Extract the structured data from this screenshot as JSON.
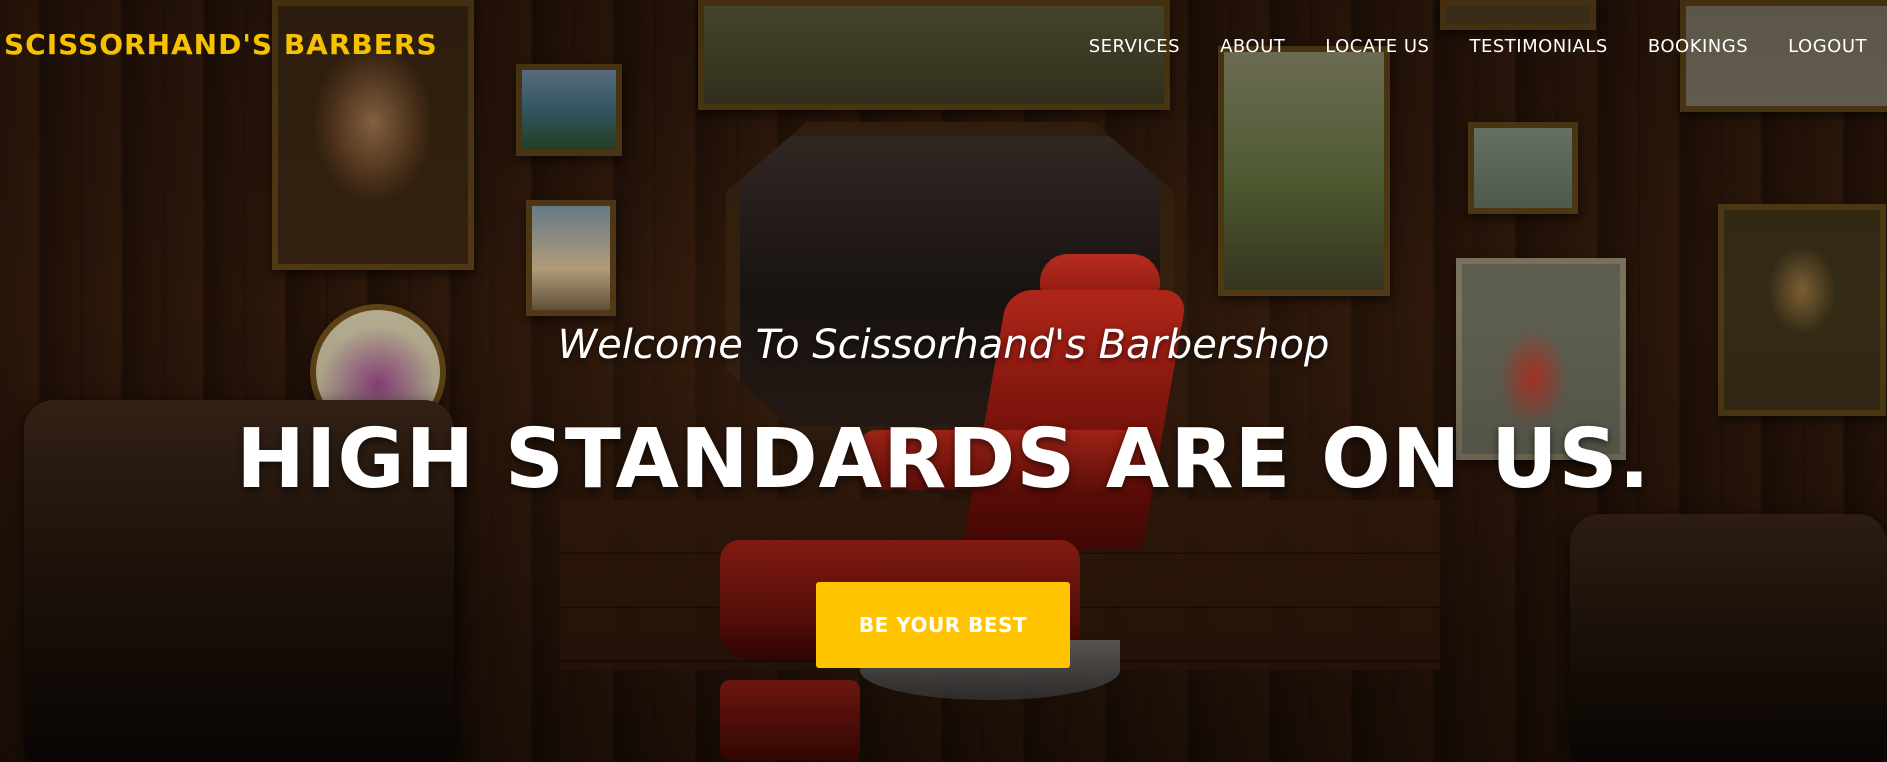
{
  "brand": {
    "name": "SCISSORHAND'S BARBERS",
    "color": "#f5c100"
  },
  "nav": {
    "items": [
      {
        "label": "SERVICES"
      },
      {
        "label": "ABOUT"
      },
      {
        "label": "LOCATE US"
      },
      {
        "label": "TESTIMONIALS"
      },
      {
        "label": "BOOKINGS"
      },
      {
        "label": "LOGOUT"
      }
    ],
    "text_color": "#ffffff"
  },
  "hero": {
    "welcome": "Welcome To Scissorhand's Barbershop",
    "headline": "HIGH STANDARDS ARE ON US.",
    "cta_label": "BE YOUR BEST",
    "cta_color": "#ffc400"
  }
}
